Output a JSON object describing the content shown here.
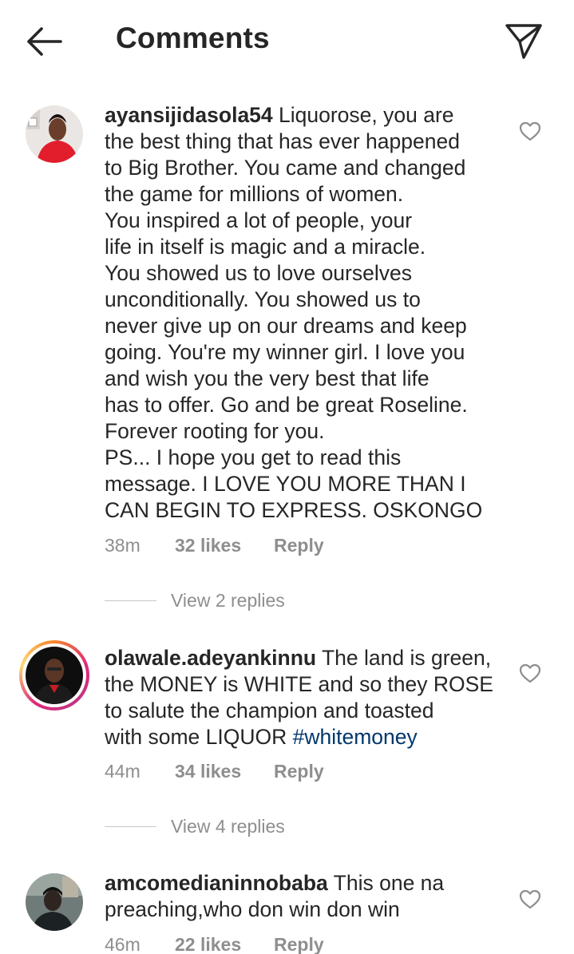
{
  "header": {
    "title": "Comments",
    "back_icon": "arrow-left-icon",
    "share_icon": "paper-plane-icon"
  },
  "comments": [
    {
      "username": "ayansijidasola54",
      "text_lines": [
        " Liquorose, you are",
        "the best thing that has ever happened",
        "to Big Brother. You came and changed",
        "the game for millions of women.",
        "You inspired a lot of people, your",
        "life in itself is magic and a miracle.",
        "You showed us to love ourselves",
        "unconditionally. You showed us to",
        "never give up on our dreams and keep",
        "going. You're my winner girl. I love you",
        "and wish you the very best that life",
        "has to offer. Go and be great Roseline.",
        "Forever rooting for you.",
        "PS... I hope you get to read this",
        "message. I LOVE YOU MORE THAN I",
        "CAN BEGIN TO EXPRESS. OSKONGO"
      ],
      "time": "38m",
      "likes": "32 likes",
      "reply": "Reply",
      "view_replies": "View 2 replies"
    },
    {
      "username": "olawale.adeyankinnu",
      "text_lines": [
        " The land is green,",
        "the MONEY is WHITE and so they ROSE",
        "to salute the champion and toasted",
        "with some LIQUOR "
      ],
      "hashtag": "#whitemoney",
      "time": "44m",
      "likes": "34 likes",
      "reply": "Reply",
      "view_replies": "View 4 replies"
    },
    {
      "username": "amcomedianinnobaba",
      "text_lines": [
        " This one na",
        "preaching,who don win don win"
      ],
      "time": "46m",
      "likes": "22 likes",
      "reply": "Reply"
    }
  ]
}
